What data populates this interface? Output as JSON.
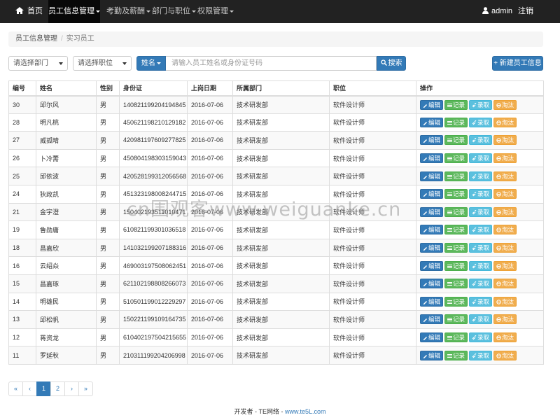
{
  "navbar": {
    "home": "首页",
    "menus": [
      {
        "label": "员工信息管理",
        "active": true
      },
      {
        "label": "考勤及薪酬",
        "active": false
      },
      {
        "label": "部门与职位",
        "active": false
      },
      {
        "label": "权限管理",
        "active": false
      }
    ],
    "user": "admin",
    "logout": "注销"
  },
  "breadcrumb": [
    "员工信息管理",
    "实习员工"
  ],
  "filters": {
    "department_placeholder": "请选择部门",
    "position_placeholder": "请选择职位",
    "search_type": "姓名",
    "search_placeholder": "请输入员工姓名或身份证号码",
    "search_button": "搜索",
    "new_button": "+ 新建员工信息"
  },
  "table": {
    "headers": [
      "编号",
      "姓名",
      "性别",
      "身份证",
      "上岗日期",
      "所属部门",
      "职位",
      "操作"
    ],
    "actions": [
      "编辑",
      "记录",
      "录取",
      "淘汰"
    ],
    "rows": [
      [
        "30",
        "邱尔风",
        "男",
        "140821199204194845",
        "2016-07-06",
        "技术研发部",
        "软件设计师"
      ],
      [
        "28",
        "明凡桃",
        "男",
        "450621198210129182",
        "2016-07-06",
        "技术研发部",
        "软件设计师"
      ],
      [
        "27",
        "威孤晴",
        "男",
        "420981197609277825",
        "2016-07-06",
        "技术研发部",
        "软件设计师"
      ],
      [
        "26",
        "卜冷薷",
        "男",
        "450804198303159043",
        "2016-07-06",
        "技术研发部",
        "软件设计师"
      ],
      [
        "25",
        "邱依波",
        "男",
        "420528199312056568",
        "2016-07-06",
        "技术研发部",
        "软件设计师"
      ],
      [
        "24",
        "狄政凯",
        "男",
        "451323198008244715",
        "2016-07-06",
        "技术研发部",
        "软件设计师"
      ],
      [
        "21",
        "金宇澄",
        "男",
        "150402193511010471",
        "2016-07-06",
        "技术研发部",
        "软件设计师"
      ],
      [
        "19",
        "鲁勋庸",
        "男",
        "610821199301036518",
        "2016-07-06",
        "技术研发部",
        "软件设计师"
      ],
      [
        "18",
        "昌嘉欣",
        "男",
        "141032199207188316",
        "2016-07-06",
        "技术研发部",
        "软件设计师"
      ],
      [
        "16",
        "云绍焱",
        "男",
        "469003197508062451",
        "2016-07-06",
        "技术研发部",
        "软件设计师"
      ],
      [
        "15",
        "昌嘉琢",
        "男",
        "621102198808266073",
        "2016-07-06",
        "技术研发部",
        "软件设计师"
      ],
      [
        "14",
        "明雄民",
        "男",
        "510501199012229297",
        "2016-07-06",
        "技术研发部",
        "软件设计师"
      ],
      [
        "13",
        "邱松帆",
        "男",
        "150221199109164735",
        "2016-07-06",
        "技术研发部",
        "软件设计师"
      ],
      [
        "12",
        "蒋资龙",
        "男",
        "610402197504215655",
        "2016-07-06",
        "技术研发部",
        "软件设计师"
      ],
      [
        "11",
        "罗延秋",
        "男",
        "210311199204206998",
        "2016-07-06",
        "技术研发部",
        "软件设计师"
      ]
    ]
  },
  "pagination": {
    "items": [
      "«",
      "‹",
      "1",
      "2",
      "›",
      "»"
    ],
    "active_index": 2
  },
  "footer": {
    "prefix": "开发者 - TE网络 - ",
    "link": "www.te5L.com"
  },
  "watermark": "cn围观客www.weiguanke.cn",
  "icons": {
    "home": "home-icon",
    "user": "user-icon",
    "search": "search-icon",
    "edit": "pencil-icon",
    "record": "list-icon",
    "hire": "link-icon",
    "reject": "eliminate-icon"
  },
  "colors": {
    "navbar": "#222222",
    "primary": "#337ab7",
    "success": "#5cb85c",
    "info": "#5bc0de",
    "warning": "#f0ad4e"
  }
}
